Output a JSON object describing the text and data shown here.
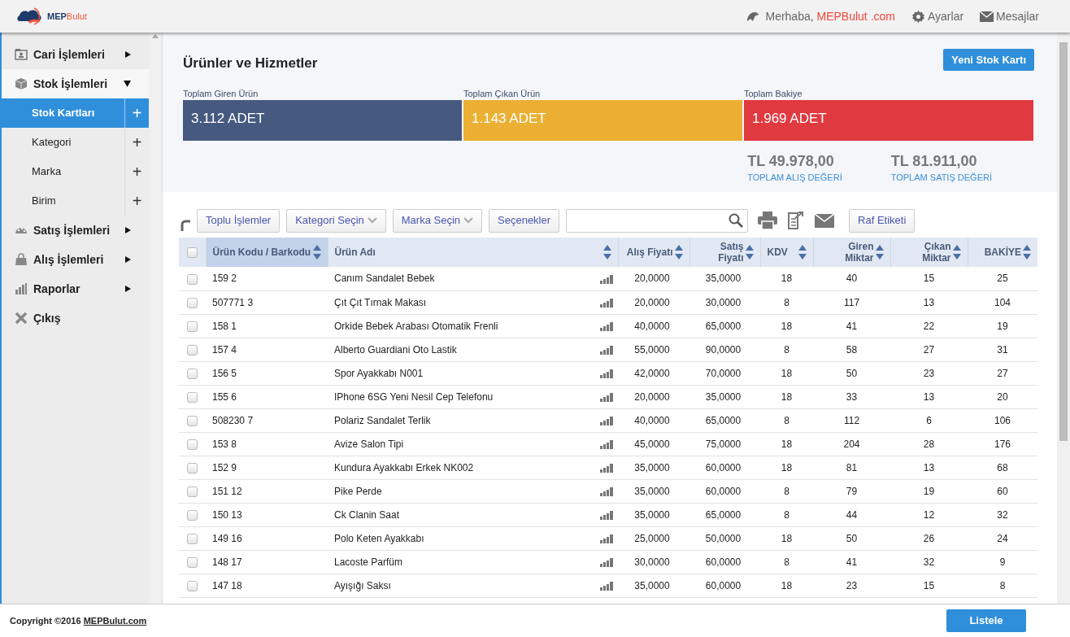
{
  "header": {
    "logo_text": {
      "first": "MEP",
      "second": "Bulut"
    },
    "greeting": "Merhaba,",
    "user": "MEPBulut .com",
    "links": [
      "Ayarlar",
      "Mesajlar"
    ]
  },
  "sidebar": {
    "items": [
      {
        "label": "Cari İşlemleri",
        "kind": "menu",
        "expanded": false
      },
      {
        "label": "Stok İşlemleri",
        "kind": "menu",
        "expanded": true,
        "children": [
          {
            "label": "Stok Kartları",
            "selected": true,
            "action": "+"
          },
          {
            "label": "Kategori",
            "selected": false,
            "action": "+"
          },
          {
            "label": "Marka",
            "selected": false,
            "action": "+"
          },
          {
            "label": "Birim",
            "selected": false,
            "action": "+"
          }
        ]
      },
      {
        "label": "Satış İşlemleri",
        "kind": "menu",
        "expanded": false
      },
      {
        "label": "Alış İşlemleri",
        "kind": "menu",
        "expanded": false
      },
      {
        "label": "Raporlar",
        "kind": "menu",
        "expanded": false
      },
      {
        "label": "Çıkış",
        "kind": "action"
      }
    ]
  },
  "page": {
    "title": "Ürünler ve Hizmetler",
    "new_button": "Yeni Stok Kartı",
    "stats": [
      {
        "label": "Toplam Giren Ürün",
        "value": "3.112 ADET",
        "color": "#465a80"
      },
      {
        "label": "Toplam Çıkan Ürün",
        "value": "1.143 ADET",
        "color": "#ebb033"
      },
      {
        "label": "Toplam Bakiye",
        "value": "1.969 ADET",
        "color": "#e0393f"
      }
    ],
    "totals": [
      {
        "value": "TL 49.978,00",
        "label": "TOPLAM ALIŞ DEĞERİ"
      },
      {
        "value": "TL 81.911,00",
        "label": "TOPLAM SATIŞ DEĞERİ"
      }
    ]
  },
  "toolbar": {
    "buttons": [
      {
        "label": "Toplu İşlemler",
        "kind": "button"
      },
      {
        "label": "Kategori Seçin",
        "kind": "dropdown"
      },
      {
        "label": "Marka Seçin",
        "kind": "dropdown"
      },
      {
        "label": "Seçenekler",
        "kind": "button"
      }
    ],
    "label_button": "Raf Etiketi"
  },
  "table": {
    "all_checked": false,
    "columns": [
      {
        "label": "Ürün Kodu / Barkodu",
        "sorted": true
      },
      {
        "label": "Ürün Adı",
        "sorted": false
      },
      {
        "label": "Alış Fiyatı",
        "sorted": false
      },
      {
        "label": "Satış Fiyatı",
        "sorted": false
      },
      {
        "label": "KDV",
        "sorted": false
      },
      {
        "label": "Giren Miktar",
        "sorted": false
      },
      {
        "label": "Çıkan Miktar",
        "sorted": false
      },
      {
        "label": "BAKİYE",
        "sorted": false
      }
    ],
    "rows": [
      {
        "checked": false,
        "cells": [
          "159 2",
          "Canım Sandalet Bebek",
          "20,0000",
          "35,0000",
          "18",
          "40",
          "15",
          "25"
        ]
      },
      {
        "checked": false,
        "cells": [
          "507771 3",
          "Çıt Çıt Tırnak Makası",
          "20,0000",
          "30,0000",
          "8",
          "117",
          "13",
          "104"
        ]
      },
      {
        "checked": false,
        "cells": [
          "158 1",
          "Orkide Bebek Arabası Otomatik Frenli",
          "40,0000",
          "65,0000",
          "18",
          "41",
          "22",
          "19"
        ]
      },
      {
        "checked": false,
        "cells": [
          "157 4",
          "Alberto Guardiani Oto Lastik",
          "55,0000",
          "90,0000",
          "8",
          "58",
          "27",
          "31"
        ]
      },
      {
        "checked": false,
        "cells": [
          "156 5",
          "Spor Ayakkabı N001",
          "42,0000",
          "70,0000",
          "18",
          "50",
          "23",
          "27"
        ]
      },
      {
        "checked": false,
        "cells": [
          "155 6",
          "IPhone 6SG Yeni Nesil Cep Telefonu",
          "20,0000",
          "35,0000",
          "18",
          "33",
          "13",
          "20"
        ]
      },
      {
        "checked": false,
        "cells": [
          "508230 7",
          "Polariz Sandalet Terlik",
          "40,0000",
          "65,0000",
          "8",
          "112",
          "6",
          "106"
        ]
      },
      {
        "checked": false,
        "cells": [
          "153 8",
          "Avize Salon Tipi",
          "45,0000",
          "75,0000",
          "18",
          "204",
          "28",
          "176"
        ]
      },
      {
        "checked": false,
        "cells": [
          "152 9",
          "Kundura Ayakkabı Erkek NK002",
          "35,0000",
          "60,0000",
          "18",
          "81",
          "13",
          "68"
        ]
      },
      {
        "checked": false,
        "cells": [
          "151 12",
          "Pike Perde",
          "35,0000",
          "60,0000",
          "8",
          "79",
          "19",
          "60"
        ]
      },
      {
        "checked": false,
        "cells": [
          "150 13",
          "Ck Clanin Saat",
          "35,0000",
          "65,0000",
          "8",
          "44",
          "12",
          "32"
        ]
      },
      {
        "checked": false,
        "cells": [
          "149 16",
          "Polo Keten Ayakkabı",
          "25,0000",
          "50,0000",
          "18",
          "50",
          "26",
          "24"
        ]
      },
      {
        "checked": false,
        "cells": [
          "148 17",
          "Lacoste Parfüm",
          "30,0000",
          "60,0000",
          "8",
          "41",
          "32",
          "9"
        ]
      },
      {
        "checked": false,
        "cells": [
          "147 18",
          "Ayışığı Saksı",
          "35,0000",
          "60,0000",
          "18",
          "23",
          "15",
          "8"
        ]
      }
    ]
  },
  "footer": {
    "copyright": "Copyright ©2016",
    "link": "MEPBulut.com",
    "button": "Listele"
  }
}
